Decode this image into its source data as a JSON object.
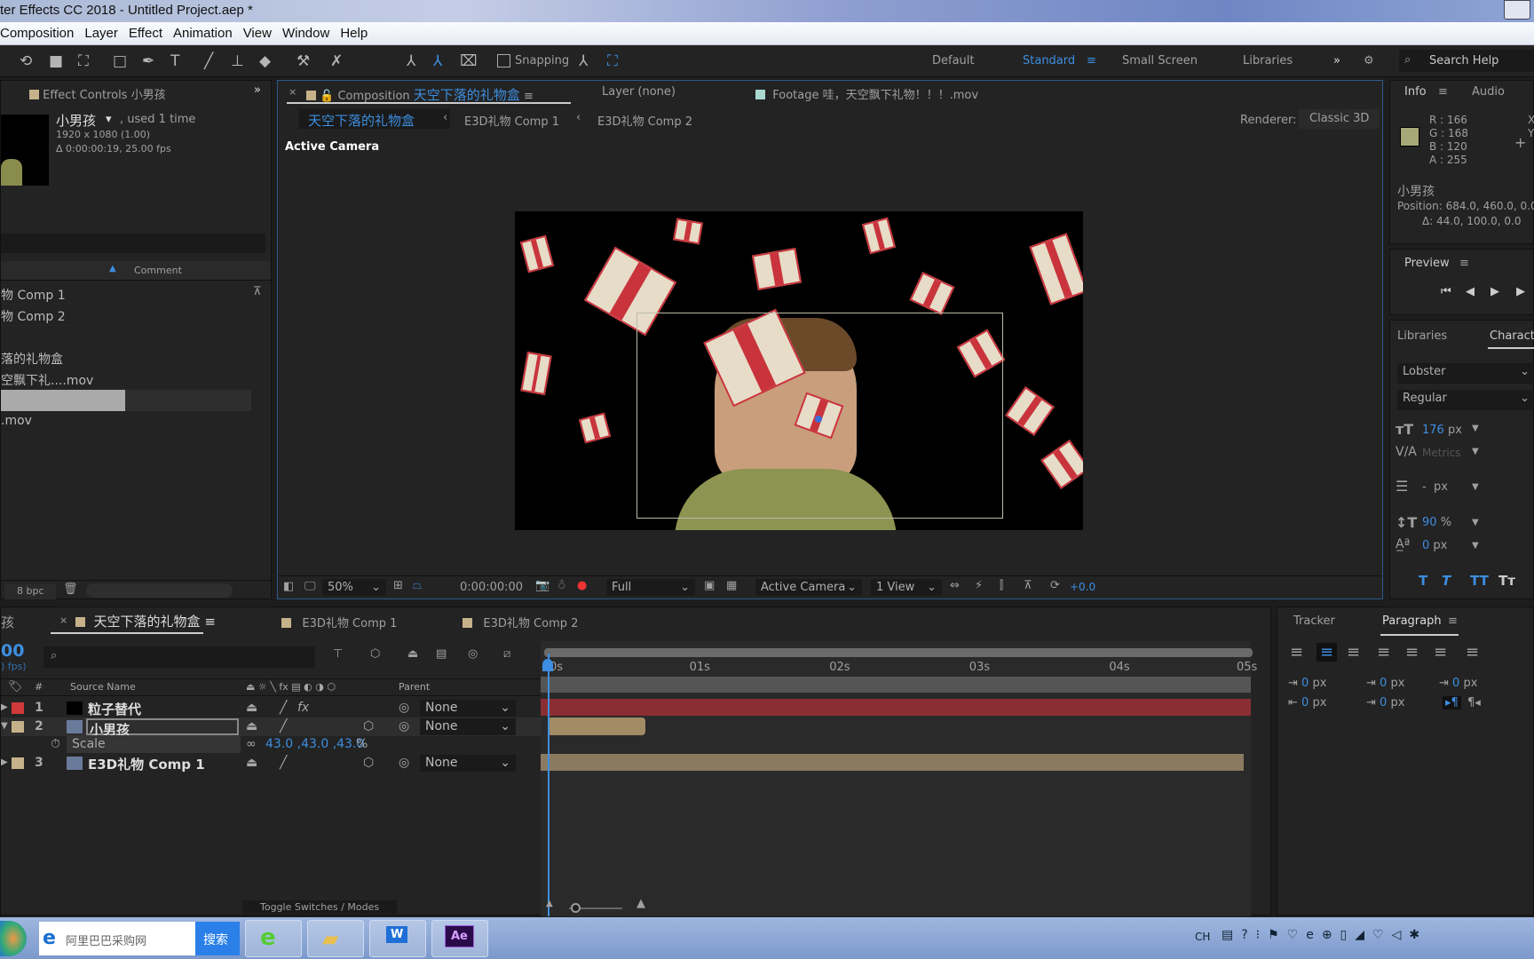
{
  "window": {
    "title": "ter Effects CC 2018 - Untitled Project.aep *"
  },
  "menu": [
    "Composition",
    "Layer",
    "Effect",
    "Animation",
    "View",
    "Window",
    "Help"
  ],
  "toolbar": {
    "snapping": "Snapping",
    "workspaces": [
      "Default",
      "Standard",
      "Small Screen",
      "Libraries"
    ],
    "active_workspace": "Standard",
    "search_placeholder": "Search Help"
  },
  "project": {
    "effect_controls_tab": "Effect Controls",
    "effect_controls_layer": "小男孩",
    "item_name": "小男孩",
    "used": ", used 1 time",
    "dimensions": "1920 x 1080 (1.00)",
    "duration": "Δ 0:00:00:19, 25.00 fps",
    "comment_col": "Comment",
    "items": [
      "物 Comp 1",
      "物 Comp 2",
      "",
      "落的礼物盒",
      "空飘下礼....mov",
      "",
      ".mov"
    ],
    "bpc": "8 bpc"
  },
  "composition": {
    "tab_label": "Composition",
    "comp_name": "天空下落的礼物盒",
    "layer_tab": "Layer  (none)",
    "footage_tab": "Footage 哇，天空飘下礼物！！！.mov",
    "breadcrumbs": [
      "天空下落的礼物盒",
      "E3D礼物 Comp 1",
      "E3D礼物 Comp 2"
    ],
    "renderer_label": "Renderer:",
    "renderer": "Classic 3D",
    "view_label": "Active Camera",
    "zoom": "50%",
    "timecode": "0:00:00:00",
    "resolution": "Full",
    "camera": "Active Camera",
    "views": "1 View",
    "exposure": "+0.0"
  },
  "info": {
    "tab": "Info",
    "audio_tab": "Audio",
    "r": "R : 166",
    "g": "G : 168",
    "b": "B : 120",
    "a": "A :  255",
    "swatch_color": "#a6a878",
    "layer": "小男孩",
    "position": "Position: 684.0, 460.0, 0.0",
    "delta": "Δ: 44.0, 100.0, 0.0",
    "x": "X",
    "y": "Y"
  },
  "preview": {
    "title": "Preview"
  },
  "character": {
    "libraries_tab": "Libraries",
    "tab": "Characte",
    "font": "Lobster",
    "style": "Regular",
    "size": "176",
    "size_unit": "px",
    "tracking": "Metrics",
    "leading": "-",
    "leading_unit": "px",
    "vscale": "90",
    "vscale_unit": "%",
    "baseline": "0",
    "baseline_unit": "px"
  },
  "timeline": {
    "tab_left": "孩",
    "active_tab": "天空下落的礼物盒",
    "tabs": [
      "E3D礼物 Comp 1",
      "E3D礼物 Comp 2"
    ],
    "timecode": "00",
    "fps": ") fps)",
    "columns": {
      "num": "#",
      "source": "Source Name",
      "parent": "Parent"
    },
    "layers": [
      {
        "num": "1",
        "name": "粒子替代",
        "label_color": "#d13a3a",
        "parent": "None",
        "bar_color": "#8a2e33"
      },
      {
        "num": "2",
        "name": "小男孩",
        "label_color": "#c6b28a",
        "parent": "None",
        "bar_color": "#a08b65"
      },
      {
        "num": "3",
        "name": "E3D礼物 Comp 1",
        "label_color": "#c6b28a",
        "parent": "None",
        "bar_color": "#8a7a60"
      }
    ],
    "property": {
      "name": "Scale",
      "value": "43.0 ,43.0 ,43.0",
      "unit": "%"
    },
    "ruler": [
      "0s",
      "01s",
      "02s",
      "03s",
      "04s",
      "05s"
    ],
    "toggle": "Toggle Switches / Modes"
  },
  "paragraph": {
    "tracker_tab": "Tracker",
    "tab": "Paragraph",
    "values": [
      "0",
      "0",
      "0",
      "0",
      "0"
    ],
    "unit": "px"
  },
  "taskbar": {
    "search_text": "阿里巴巴采购网",
    "search_button": "搜索",
    "ae": "Ae",
    "lang": "CH"
  }
}
